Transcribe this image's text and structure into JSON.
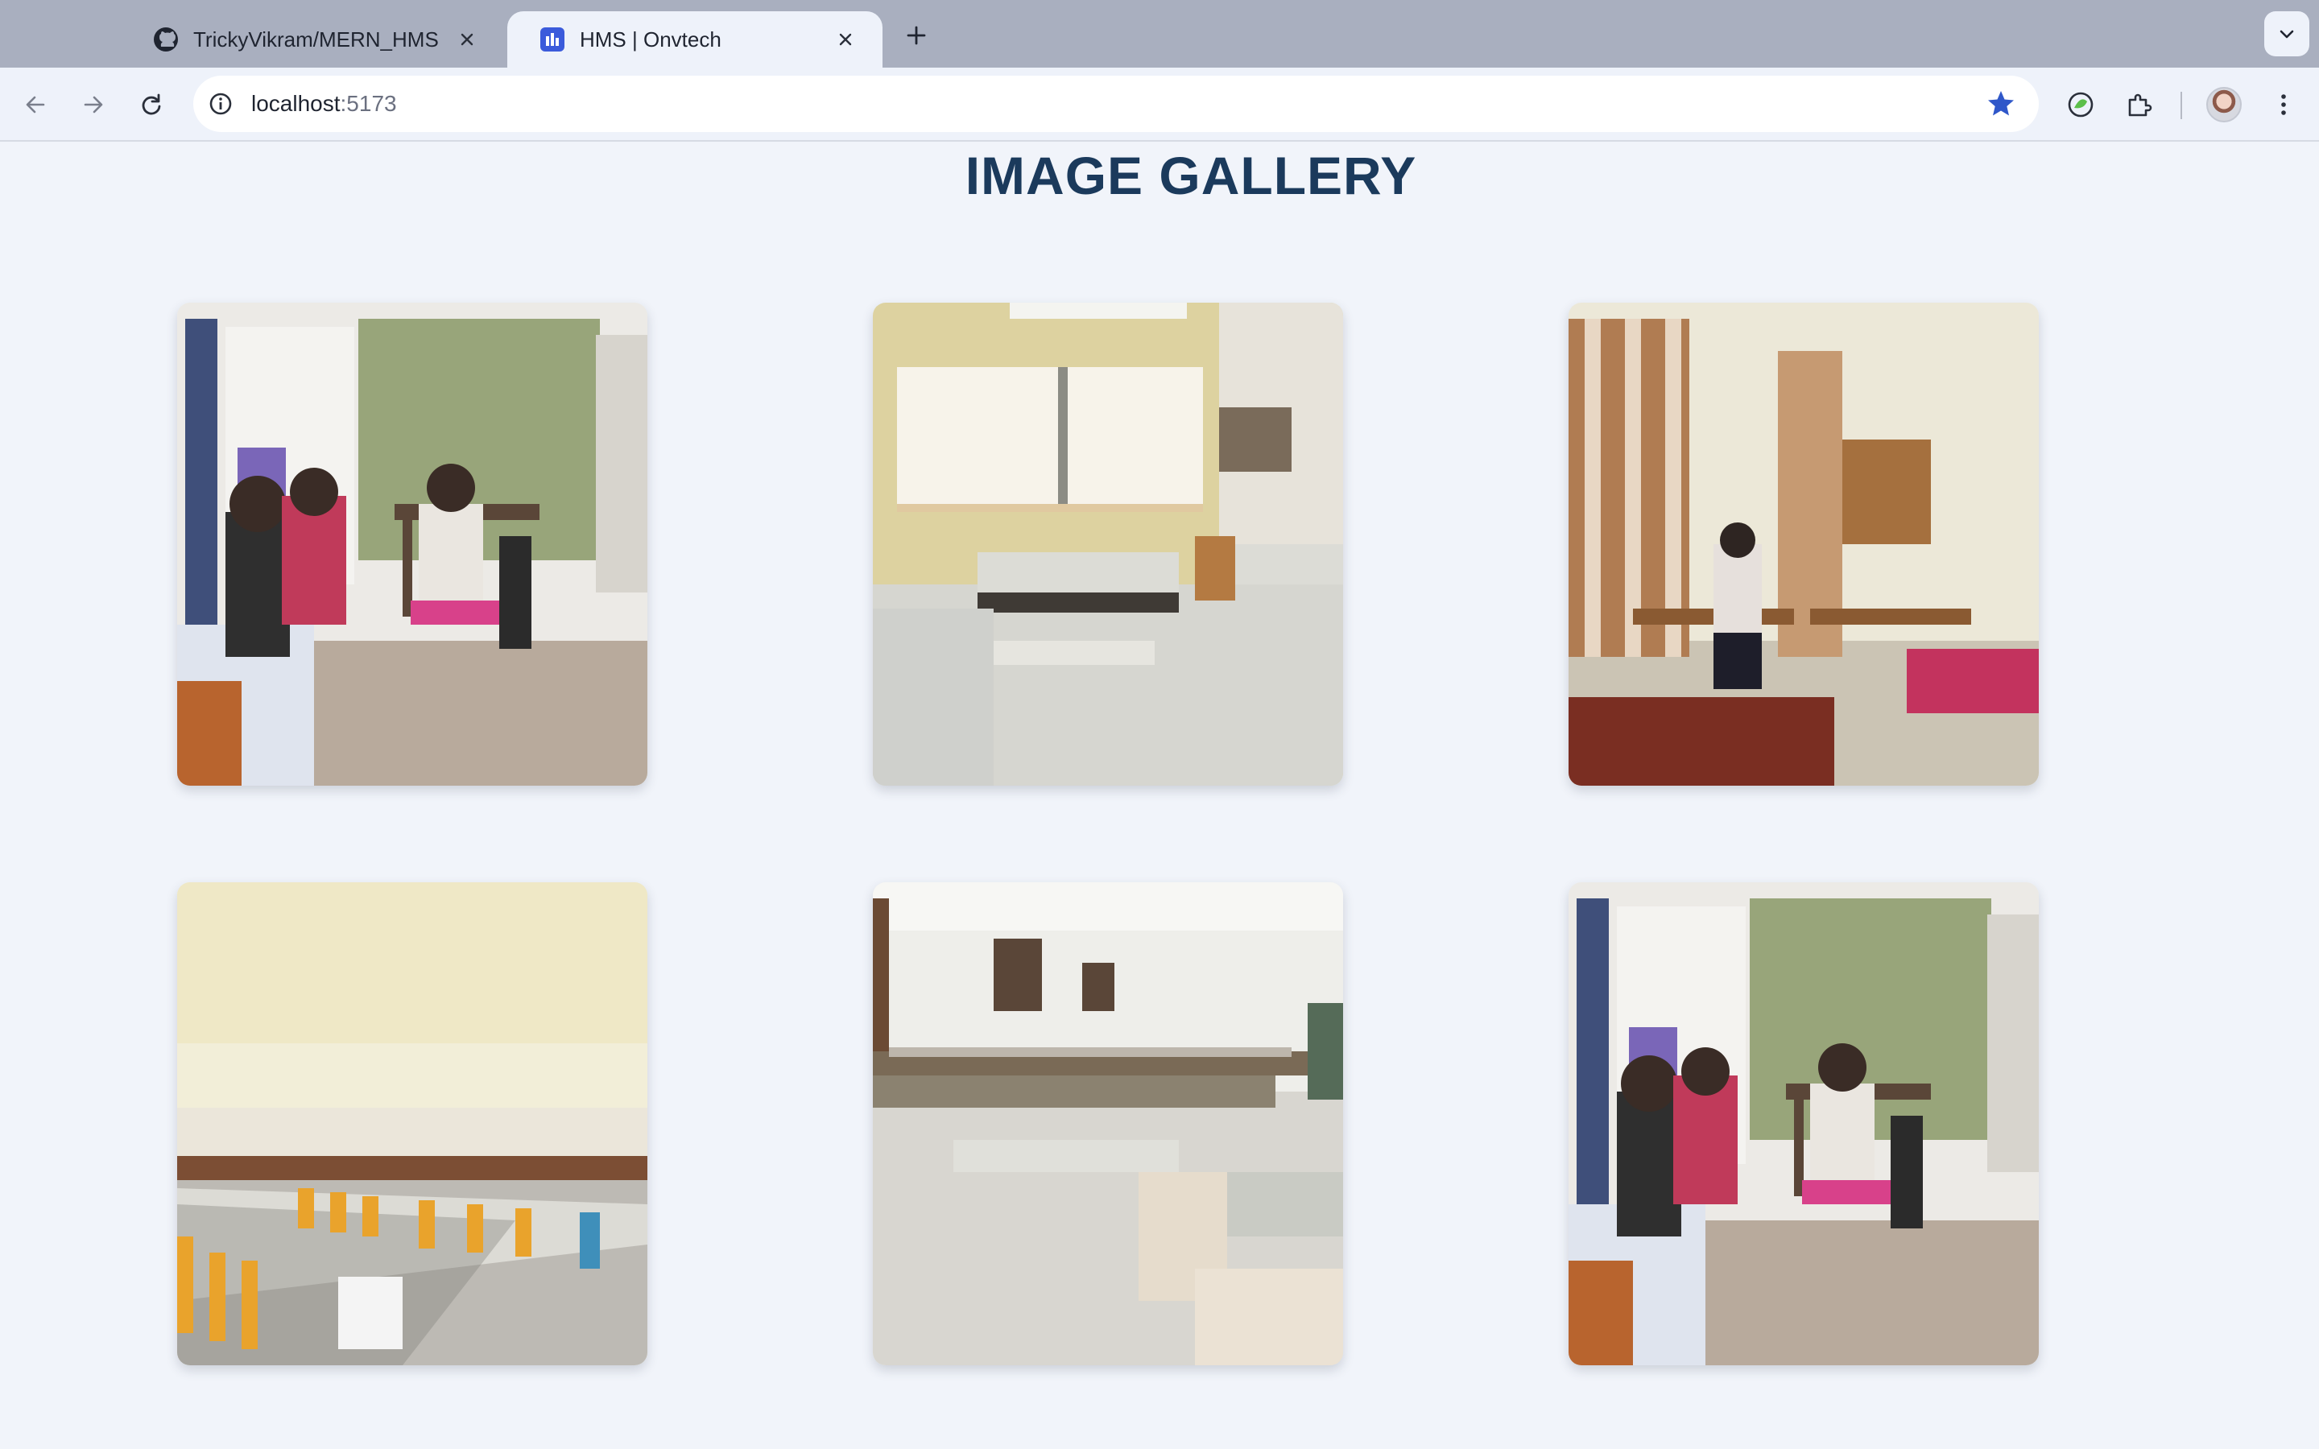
{
  "browser": {
    "tabs": [
      {
        "title": "TrickyVikram/MERN_HMS",
        "icon": "github-icon",
        "active": false
      },
      {
        "title": "HMS | Onvtech",
        "icon": "app-favicon-icon",
        "active": true
      }
    ],
    "address": {
      "host": "localhost",
      "port": ":5173"
    },
    "accent_color": "#3b5bdb"
  },
  "page": {
    "title": "IMAGE GALLERY",
    "title_color": "#1b3a5c",
    "images": [
      {
        "subject": "hostel room with students"
      },
      {
        "subject": "twin bed hostel room"
      },
      {
        "subject": "study room with desks"
      },
      {
        "subject": "dining hall"
      },
      {
        "subject": "common hall"
      },
      {
        "subject": "hostel room with students"
      }
    ]
  }
}
